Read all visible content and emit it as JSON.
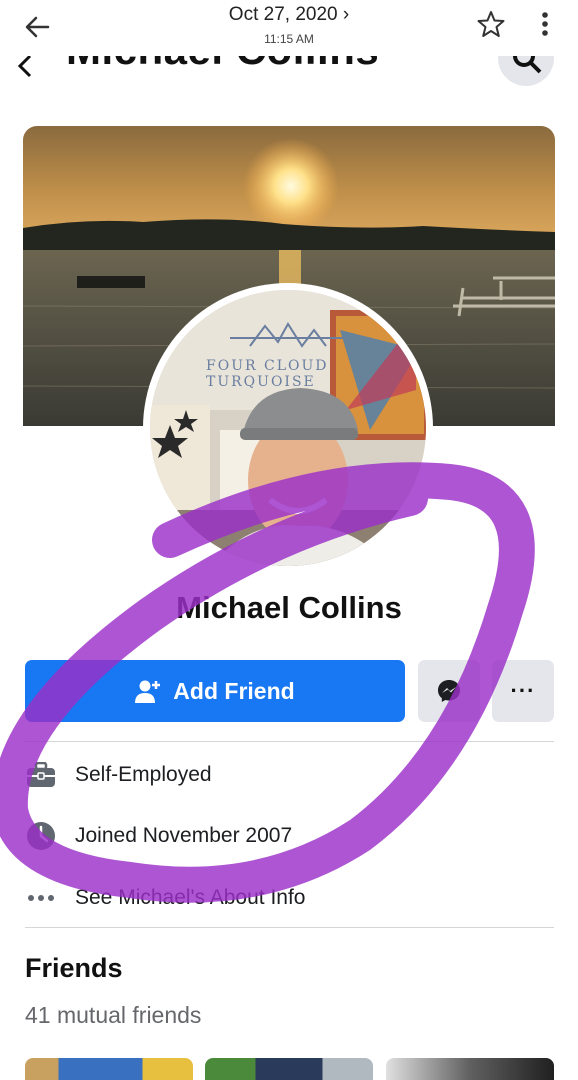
{
  "viewer": {
    "date": "Oct 27, 2020 ›",
    "time": "11:15 AM"
  },
  "previous_header": {
    "title": "Michael Collins"
  },
  "cover_photo": {
    "description_icon": "lake-sunset-photo"
  },
  "profile_picture": {
    "watermark": "FOUR CLOUD TURQUOISE"
  },
  "profile": {
    "name": "Michael Collins"
  },
  "actions": {
    "add_friend_label": "Add Friend",
    "more_label": "···"
  },
  "info": {
    "work": "Self-Employed",
    "joined": "Joined November 2007",
    "about": "See Michael's About Info"
  },
  "friends": {
    "title": "Friends",
    "mutual": "41 mutual friends"
  },
  "colors": {
    "primary_button": "#1877f2",
    "secondary_button": "#e4e6eb",
    "scribble": "#9b30c8"
  },
  "icons": [
    "back-arrow-icon",
    "star-icon",
    "more-vert-icon",
    "search-icon",
    "add-friend-icon",
    "messenger-icon",
    "more-horizontal-icon",
    "briefcase-icon",
    "clock-icon",
    "ellipsis-icon"
  ]
}
